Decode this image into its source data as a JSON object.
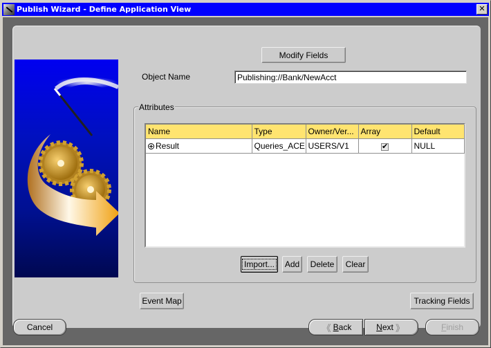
{
  "window": {
    "title": "Publish Wizard - Define Application View",
    "close_label": "✕"
  },
  "top": {
    "modify_fields_label": "Modify Fields",
    "object_name_label": "Object Name",
    "object_name_value": "Publishing://Bank/NewAcct"
  },
  "attributes": {
    "legend": "Attributes",
    "columns": [
      "Name",
      "Type",
      "Owner/Ver...",
      "Array",
      "Default"
    ],
    "rows": [
      {
        "name": "Result",
        "type": "Queries_ACE",
        "owner": "USERS/V1",
        "array": true,
        "default": "NULL"
      }
    ],
    "buttons": {
      "import": "Import...",
      "add": "Add",
      "delete": "Delete",
      "clear": "Clear"
    }
  },
  "lower": {
    "event_map_label": "Event Map",
    "tracking_fields_label": "Tracking Fields"
  },
  "nav": {
    "cancel_label": "Cancel",
    "back_mnemonic": "B",
    "back_rest": "ack",
    "next_mnemonic": "N",
    "next_rest": "ext",
    "finish_mnemonic": "F",
    "finish_rest": "inish",
    "finish_enabled": false
  },
  "icons": {
    "back_chevron": "《",
    "next_chevron": "》",
    "checkmark": "✔"
  },
  "colors": {
    "titlebar": "#0000ff",
    "header_yellow": "#ffe470",
    "frame_dark": "#666666",
    "panel": "#cccccc"
  }
}
